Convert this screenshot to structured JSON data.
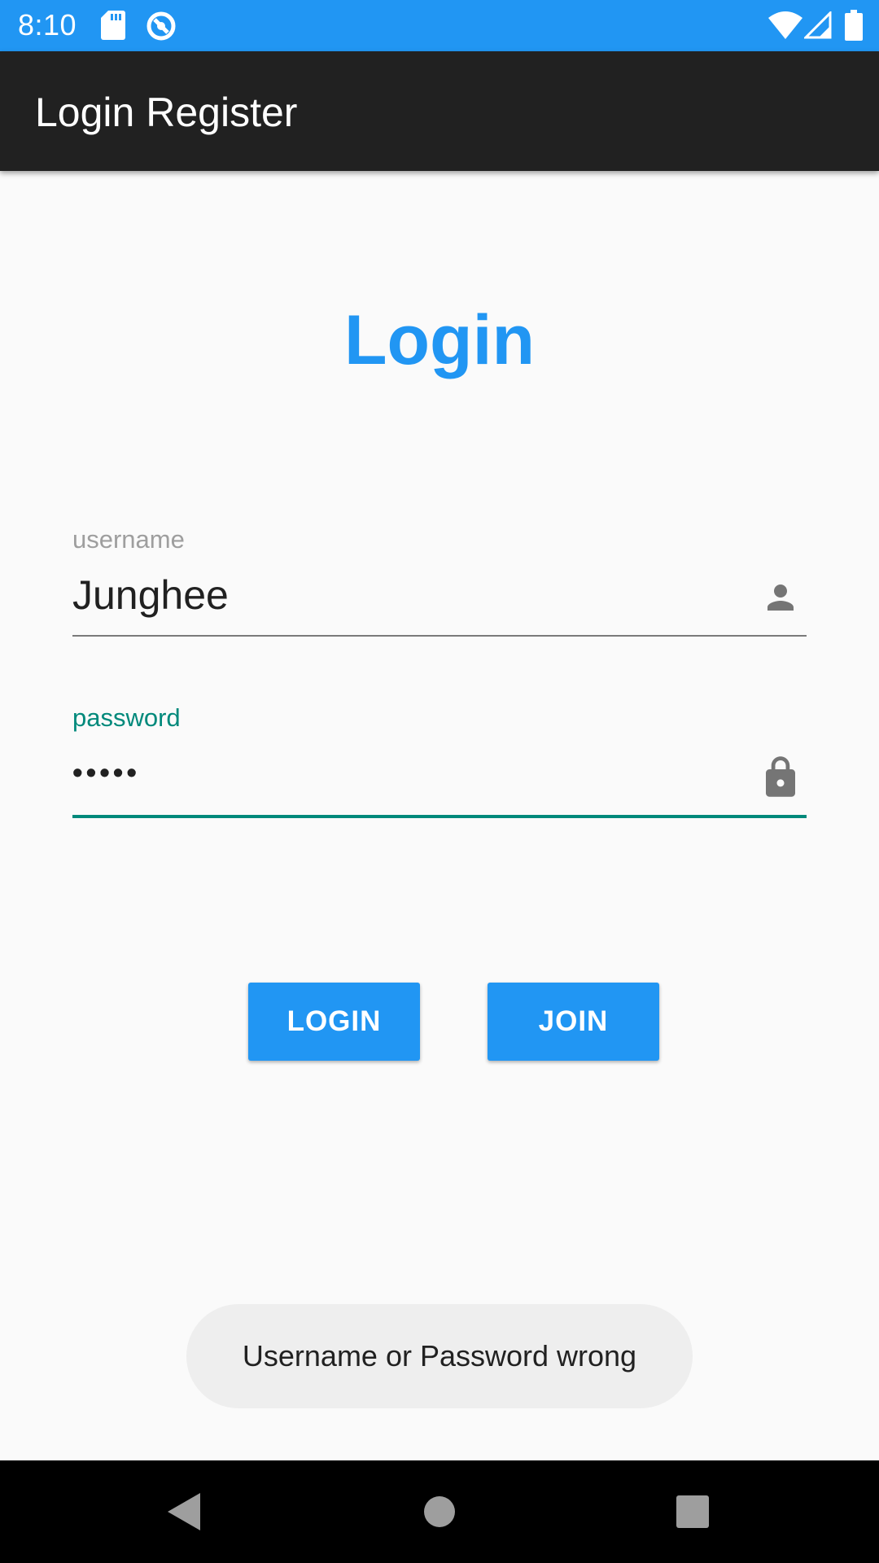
{
  "status_bar": {
    "time": "8:10",
    "icons": [
      "sd-card-icon",
      "sync-icon",
      "wifi-icon",
      "signal-icon",
      "battery-icon"
    ],
    "background": "#2196f3"
  },
  "app_bar": {
    "title": "Login Register",
    "background": "#212121"
  },
  "heading": "Login",
  "form": {
    "username": {
      "label": "username",
      "value": "Junghee",
      "icon": "person-icon"
    },
    "password": {
      "label": "password",
      "value": "•••••",
      "icon": "lock-icon"
    }
  },
  "buttons": {
    "login": "LOGIN",
    "join": "JOIN"
  },
  "toast": {
    "message": "Username or Password wrong"
  },
  "nav_bar": {
    "icons": [
      "back-icon",
      "home-icon",
      "recents-icon"
    ]
  },
  "colors": {
    "accent": "#2196f3",
    "focus": "#00897b",
    "background": "#fafafa"
  }
}
